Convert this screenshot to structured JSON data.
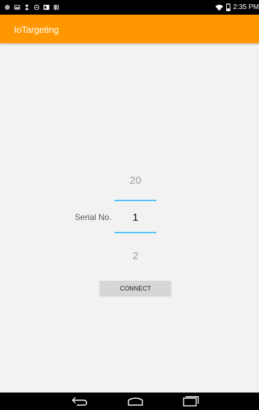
{
  "status_bar": {
    "time": "2:35 PM",
    "icons_left": [
      "notification-icon",
      "image-icon",
      "hourglass-icon",
      "minus-circle-icon",
      "gplus-icon",
      "barcode-icon"
    ],
    "icons_right": [
      "wifi-icon",
      "battery-icon"
    ]
  },
  "app_bar": {
    "title": "IoTargeting",
    "color": "#ff9800"
  },
  "form": {
    "serial_label": "Serial No.",
    "picker": {
      "previous": "20",
      "current": "1",
      "next": "2",
      "accent": "#4fc3f7"
    },
    "connect_label": "CONNECT"
  },
  "nav_bar": {
    "icons": [
      "back-icon",
      "home-icon",
      "recents-icon"
    ]
  }
}
